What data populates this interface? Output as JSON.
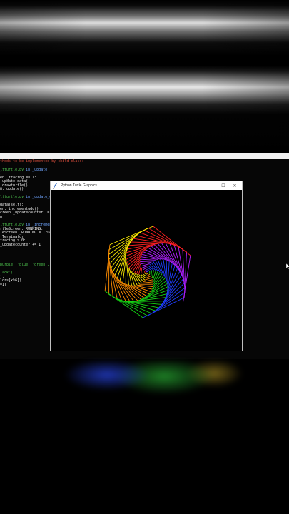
{
  "window": {
    "title": "Python Turtle Graphics",
    "minimize_glyph": "—",
    "maximize_glyph": "☐",
    "close_glyph": "✕"
  },
  "editor": {
    "lines": [
      {
        "text": "thods to be implemented by child class:",
        "color": "red"
      },
      {
        "text": "",
        "color": "white"
      },
      {
        "text": "ltturtle.py ",
        "color": "green",
        "suffix": "in _update",
        "suffix_color": "blue"
      },
      {
        "text": ")",
        "color": "white"
      },
      {
        "text": "en._tracing == 1:",
        "color": "white"
      },
      {
        "text": "_update_data()",
        "color": "white"
      },
      {
        "text": "_drawturtle()",
        "color": "white"
      },
      {
        "text": "n._update()",
        "color": "white"
      },
      {
        "text": "",
        "color": "white"
      },
      {
        "text": "ltturtle.py ",
        "color": "green",
        "suffix": "in _update_da",
        "suffix_color": "blue"
      },
      {
        "text": "",
        "color": "white"
      },
      {
        "text": "data(self):",
        "color": "white"
      },
      {
        "text": "en._incrementudc()",
        "color": "white"
      },
      {
        "text": "creen._updatecounter != 0:",
        "color": "white"
      },
      {
        "text": "n",
        "color": "white"
      },
      {
        "text": "",
        "color": "white"
      },
      {
        "text": "ltturtle.py ",
        "color": "green",
        "suffix": "in _incrementu",
        "suffix_color": "blue"
      },
      {
        "text": "rtleScreen._RUNNING:",
        "color": "white"
      },
      {
        "text": "leScreen._RUNNING = True",
        "color": "white"
      },
      {
        "text": " Terminator",
        "color": "white"
      },
      {
        "text": "tracing > 0:",
        "color": "white"
      },
      {
        "text": "_updatecounter += 1",
        "color": "white"
      },
      {
        "text": "",
        "color": "white"
      },
      {
        "text": "",
        "color": "white"
      },
      {
        "text": "purple','blue','green','ora",
        "color": "green"
      },
      {
        "text": "",
        "color": "white"
      },
      {
        "text": "lack')",
        "color": "green"
      },
      {
        "text": "):",
        "color": "white"
      },
      {
        "text": "lors[x%6])",
        "color": "white"
      },
      {
        "text": "=1)",
        "color": "white"
      }
    ]
  },
  "drawing": {
    "palette": [
      "#ff2020",
      "#b020ff",
      "#1f3dff",
      "#14d414",
      "#ff8c00",
      "#ffee00"
    ],
    "sides": 6,
    "segments": 140
  },
  "icons": {
    "feather": "feather-icon",
    "cursor": "mouse-cursor-icon"
  }
}
